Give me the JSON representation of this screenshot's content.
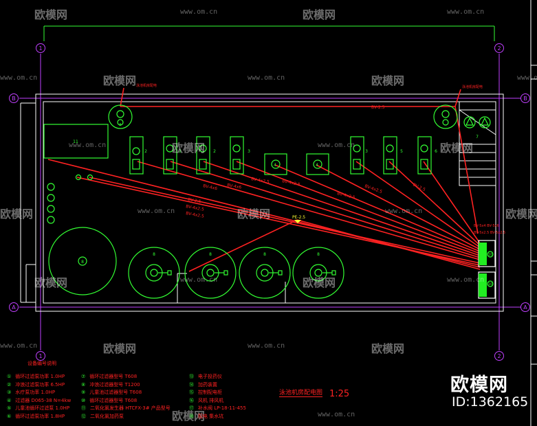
{
  "axes": {
    "col1": "1",
    "col2": "2",
    "rowA": "A",
    "rowB": "B"
  },
  "cable_labels": [
    "BV-2.5",
    "BV-2.5",
    "BV-4x6",
    "BV-4x6",
    "BV-4x2.5",
    "BV-4x2.5",
    "BV-4x2.5",
    "BV-4x2.5",
    "BV-2.5",
    "BV-4x2.5",
    "BV-4x2.5",
    "PE-2.5"
  ],
  "equipment_markers": {
    "pumps": [
      "2",
      "2",
      "2",
      "3",
      "3",
      "4",
      "4",
      "5",
      "5",
      "6"
    ],
    "tanks": [
      "8",
      "8",
      "8",
      "8",
      "8"
    ],
    "panels": [
      "10",
      "10"
    ],
    "misc": [
      "9",
      "11",
      "7"
    ]
  },
  "legend": {
    "header": "设备编号说明",
    "items": [
      {
        "n": "①",
        "text": "循环过滤泵功率 1.0HP"
      },
      {
        "n": "②",
        "text": "冲浪过滤泵功率 6.5HP"
      },
      {
        "n": "③",
        "text": "水疗泵功率 1.0HP"
      },
      {
        "n": "④",
        "text": "过滤器 D065-38 N=4kw"
      },
      {
        "n": "⑤",
        "text": "儿童池循环过滤泵 1.0HP"
      },
      {
        "n": "⑥",
        "text": "循环过滤泵功率 1.8HP"
      },
      {
        "n": "⑦",
        "text": "循环过滤器型号 T608"
      },
      {
        "n": "⑧",
        "text": "冲浪过滤器型号 T1200"
      },
      {
        "n": "⑨",
        "text": "儿童池过滤器型号 T608"
      },
      {
        "n": "⑩",
        "text": "循环过滤器型号 T608"
      },
      {
        "n": "⑪",
        "text": "二氧化氯发生器 HTCFX-3# 产品型号"
      },
      {
        "n": "⑫",
        "text": "二氧化氯加药泵"
      },
      {
        "n": "⑬",
        "text": "电子投药仪"
      },
      {
        "n": "⑭",
        "text": "加药装置"
      },
      {
        "n": "⑮",
        "text": "控制配电柜"
      },
      {
        "n": "⑯",
        "text": "风机 排风机"
      },
      {
        "n": "⑰",
        "text": "补水阀 LP-18-11-455"
      },
      {
        "n": "⑱",
        "text": "配电 集水坑"
      }
    ]
  },
  "title": "泳池机房配电图",
  "scale": "1:25",
  "top_left_note": "泳池机房配电",
  "right_note_1": "BV-5x4 BV-5x6",
  "right_note_2": "BV-5x2.5 BV-5x2.5",
  "watermark": {
    "brand": "欧模网",
    "url": "www.om.cn"
  },
  "brand_badge": {
    "name": "欧模网",
    "id": "ID:1362165"
  },
  "colors": {
    "background": "#000000",
    "outline": "#ffffff",
    "equipment": "#33ff33",
    "wiring": "#ff2222",
    "axis": "#c040ff",
    "panel_fill": "#22ee22",
    "marker": "#ffff33"
  }
}
